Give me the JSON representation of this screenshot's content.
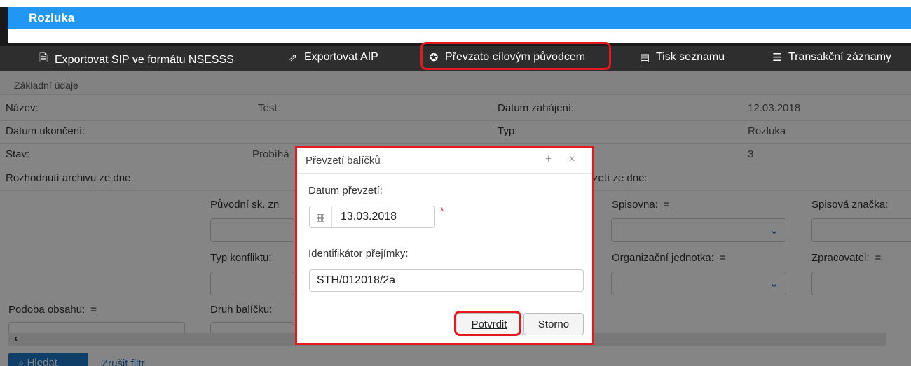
{
  "window": {
    "title": "Rozluka"
  },
  "toolbar": {
    "items": [
      {
        "label": "Exportovat SIP ve formátu NSESSS",
        "icon": "export-sip-icon"
      },
      {
        "label": "Exportovat AIP",
        "icon": "export-icon"
      },
      {
        "label": "Převzato cílovým původcem",
        "icon": "award-icon",
        "highlighted": true
      },
      {
        "label": "Tisk seznamu",
        "icon": "print-list-icon"
      },
      {
        "label": "Transakční záznamy",
        "icon": "list-icon"
      }
    ]
  },
  "details": {
    "section_title": "Základní údaje",
    "rows": [
      {
        "label": "Název:",
        "value": "Test",
        "label2": "Datum zahájení:",
        "value2": "12.03.2018"
      },
      {
        "label": "Datum ukončení:",
        "value": "",
        "label2": "Typ:",
        "value2": "Rozluka"
      },
      {
        "label": "Stav:",
        "value": "Probíhá",
        "label2": "",
        "value2": "3"
      },
      {
        "label": "Rozhodnutí archivu ze dne:",
        "value": "",
        "label2": "zetí ze dne:",
        "value2": ""
      }
    ]
  },
  "filters": {
    "puvodni_sk_zn": "Původní sk. zn",
    "spisovna": "Spisovna:",
    "spisova_znacka": "Spisová značka:",
    "typ_konfliktu": "Typ konfliktu:",
    "organizacni_jednotka": "Organizační jednotka:",
    "zpracovatel": "Zpracovatel:",
    "podoba_obsahu": "Podoba obsahu:",
    "druh_balicku": "Druh balíčku:",
    "eq_symbol": "="
  },
  "actions": {
    "search_label": "Hledat",
    "clear_label": "Zrušit filtr"
  },
  "modal": {
    "title": "Převzetí balíčků",
    "controls": "+ ×",
    "date_label": "Datum převzetí:",
    "date_value": "13.03.2018",
    "required_mark": "*",
    "id_label": "Identifikátor přejímky:",
    "id_value": "STH/012018/2a",
    "confirm_label": "Potvrdit",
    "cancel_label": "Storno"
  },
  "colors": {
    "accent": "#2196f3",
    "toolbar": "#2e2e2e",
    "highlight": "#e8161d"
  }
}
